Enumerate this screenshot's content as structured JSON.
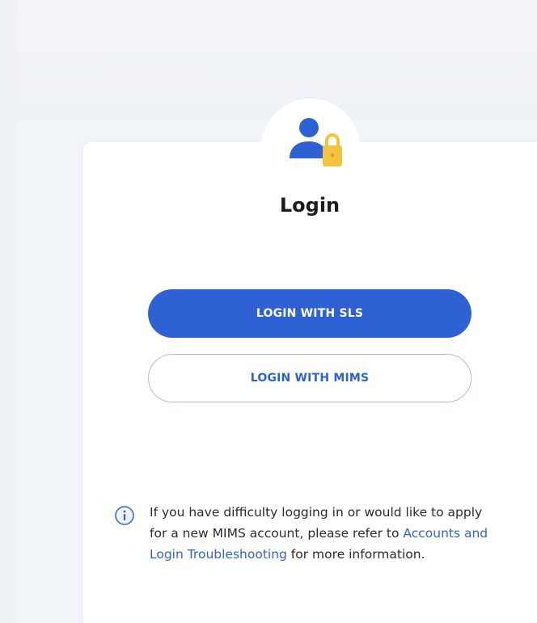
{
  "login": {
    "title": "Login",
    "sls_button_label": "LOGIN WITH SLS",
    "mims_button_label": "LOGIN WITH MIMS"
  },
  "info": {
    "text_before_link": "If you have difficulty logging in or would like to apply for a new MIMS account, please refer to ",
    "link_text": "Accounts and Login Troubleshooting",
    "text_after_link": " for more information."
  },
  "icons": {
    "avatar": "user-lock-icon",
    "info": "info-circle-icon"
  },
  "colors": {
    "primary": "#2e62d4",
    "lock": "#f5c242",
    "background": "#f1f4f8",
    "card": "#ffffff"
  }
}
